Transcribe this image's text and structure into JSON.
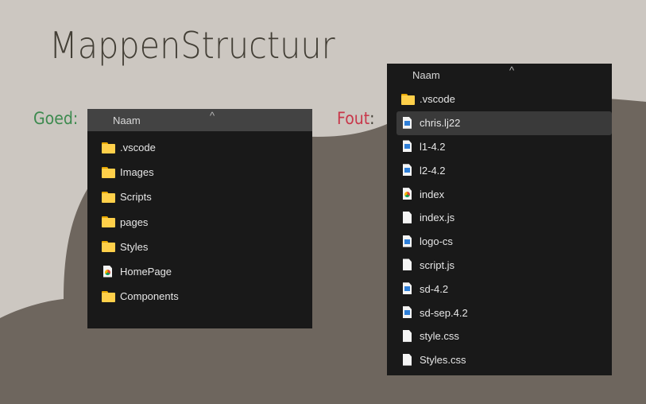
{
  "title": "MappenStructuur",
  "colors": {
    "background": "#ccc7c1",
    "shape": "#6e665e",
    "good": "#3d8a4f",
    "bad": "#c8374a"
  },
  "good": {
    "label": "Goed",
    "colon": ":",
    "column_header": "Naam",
    "items": [
      {
        "name": ".vscode",
        "icon": "folder-icon"
      },
      {
        "name": "Images",
        "icon": "folder-icon"
      },
      {
        "name": "Scripts",
        "icon": "folder-icon"
      },
      {
        "name": "pages",
        "icon": "folder-icon"
      },
      {
        "name": "Styles",
        "icon": "folder-icon"
      },
      {
        "name": "HomePage",
        "icon": "chrome-file-icon"
      },
      {
        "name": "Components",
        "icon": "folder-icon"
      }
    ]
  },
  "bad": {
    "label": "Fout",
    "colon": ":",
    "column_header": "Naam",
    "items": [
      {
        "name": ".vscode",
        "icon": "folder-icon"
      },
      {
        "name": "chris.lj22",
        "icon": "image-file-icon",
        "selected": true
      },
      {
        "name": "l1-4.2",
        "icon": "image-file-icon"
      },
      {
        "name": "l2-4.2",
        "icon": "image-file-icon"
      },
      {
        "name": "index",
        "icon": "chrome-file-icon"
      },
      {
        "name": "index.js",
        "icon": "file-icon"
      },
      {
        "name": "logo-cs",
        "icon": "image-file-icon"
      },
      {
        "name": "script.js",
        "icon": "file-icon"
      },
      {
        "name": "sd-4.2",
        "icon": "image-file-icon"
      },
      {
        "name": "sd-sep.4.2",
        "icon": "image-file-icon"
      },
      {
        "name": "style.css",
        "icon": "file-icon"
      },
      {
        "name": "Styles.css",
        "icon": "file-icon"
      }
    ]
  }
}
